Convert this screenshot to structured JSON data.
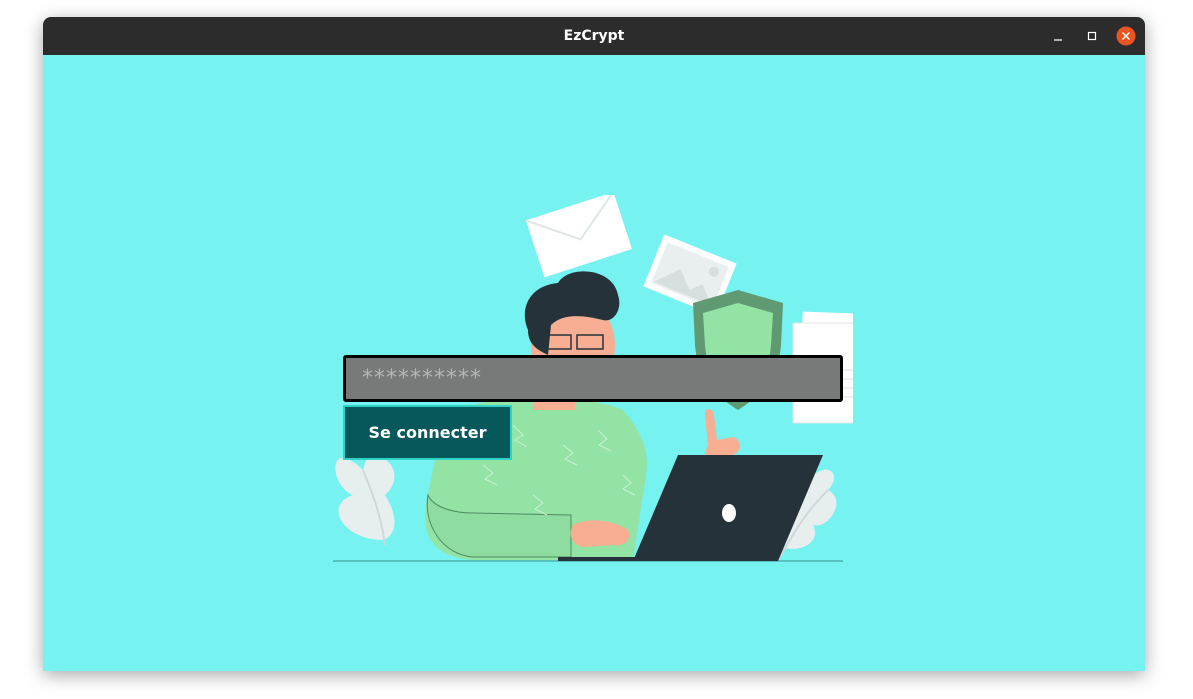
{
  "window": {
    "title": "EzCrypt",
    "controls": [
      "minimize-icon",
      "maximize-icon",
      "close-icon"
    ]
  },
  "login": {
    "password_placeholder": "**********",
    "password_value": "",
    "submit_label": "Se connecter"
  },
  "colors": {
    "background": "#76f2f0",
    "titlebar": "#2c2c2c",
    "input_bg": "#787a7a",
    "button_bg": "#06585a",
    "button_border": "#2ed3c6",
    "close_button": "#e95420"
  }
}
